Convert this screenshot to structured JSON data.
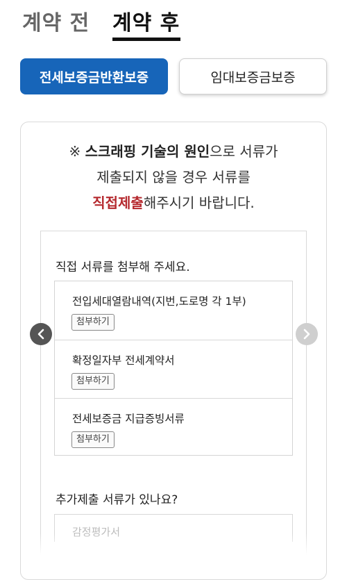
{
  "tabs": {
    "before": "계약 전",
    "after": "계약 후"
  },
  "guarantee_buttons": {
    "active": "전세보증금반환보증",
    "inactive": "임대보증금보증"
  },
  "notice": {
    "symbol": "※",
    "bold_text": "스크래핑 기술의 원인",
    "line1_rest": "으로 서류가",
    "line2": "제출되지 않을 경우 서류를",
    "red_text": "직접제출",
    "line3_rest": "해주시기 바랍니다."
  },
  "direct_section": {
    "title": "직접 서류를 첨부해 주세요.",
    "documents": [
      {
        "name": "전입세대열람내역(지번,도로명 각 1부)",
        "button": "첨부하기"
      },
      {
        "name": "확정일자부 전세계약서",
        "button": "첨부하기"
      },
      {
        "name": "전세보증금 지급증빙서류",
        "button": "첨부하기"
      }
    ]
  },
  "additional_section": {
    "title": "추가제출 서류가 있나요?",
    "partial_item": "감정평가서"
  },
  "colors": {
    "accent": "#1765b9",
    "highlight": "#b5292e"
  },
  "icons": {
    "prev": "chevron-left-icon",
    "next": "chevron-right-icon"
  }
}
